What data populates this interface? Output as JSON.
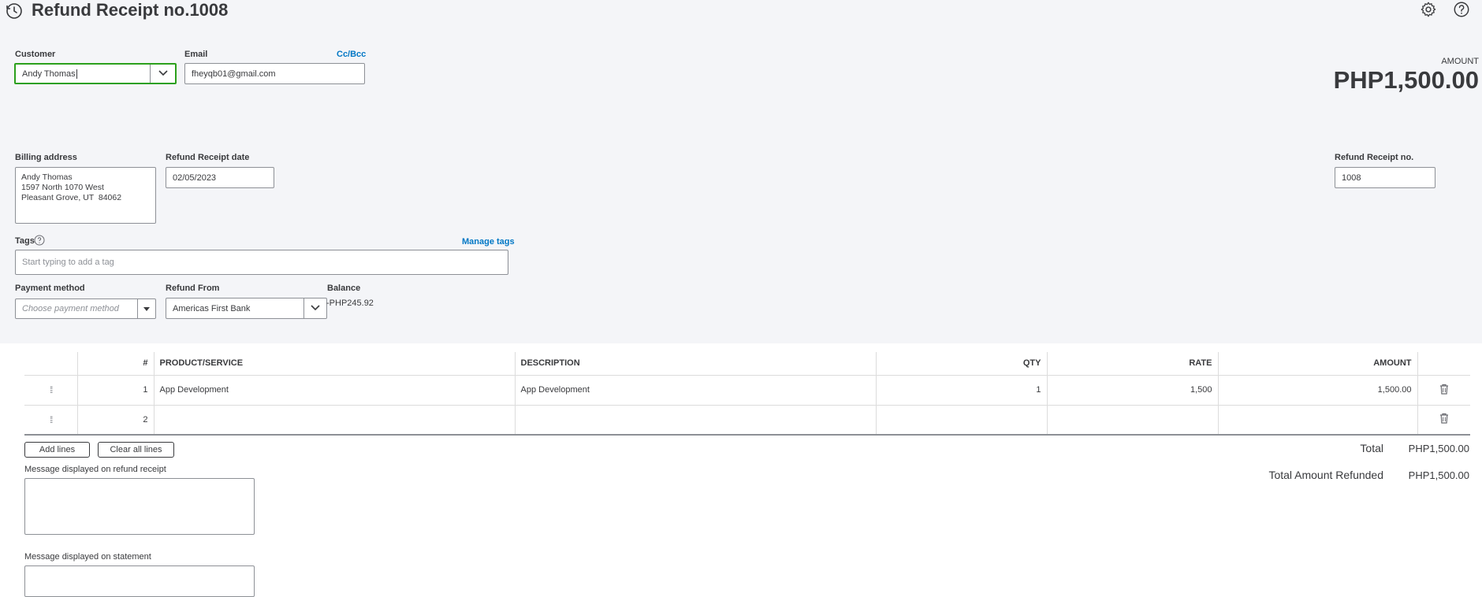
{
  "header": {
    "title": "Refund Receipt no.1008",
    "history_icon": "history-clock-icon",
    "settings_icon": "gear-icon",
    "help_icon": "help-icon"
  },
  "customer": {
    "label": "Customer",
    "value": "Andy Thomas"
  },
  "email": {
    "label": "Email",
    "value": "fheyqb01@gmail.com",
    "cc_bcc": "Cc/Bcc"
  },
  "amount": {
    "label": "AMOUNT",
    "value": "PHP1,500.00"
  },
  "billing": {
    "label": "Billing address",
    "lines": [
      "Andy Thomas",
      "1597 North 1070 West",
      "Pleasant Grove, UT  84062"
    ]
  },
  "receipt_date": {
    "label": "Refund Receipt date",
    "value": "02/05/2023"
  },
  "receipt_no": {
    "label": "Refund Receipt no.",
    "value": "1008"
  },
  "tags": {
    "label": "Tags",
    "manage": "Manage tags",
    "placeholder": "Start typing to add a tag"
  },
  "payment_method": {
    "label": "Payment method",
    "placeholder": "Choose payment method"
  },
  "refund_from": {
    "label": "Refund From",
    "value": "Americas First Bank"
  },
  "balance": {
    "label": "Balance",
    "value": "-PHP245.92"
  },
  "table": {
    "columns": [
      "#",
      "PRODUCT/SERVICE",
      "DESCRIPTION",
      "QTY",
      "RATE",
      "AMOUNT"
    ],
    "rows": [
      {
        "num": "1",
        "product": "App Development",
        "description": "App Development",
        "qty": "1",
        "rate": "1,500",
        "amount": "1,500.00"
      },
      {
        "num": "2",
        "product": "",
        "description": "",
        "qty": "",
        "rate": "",
        "amount": ""
      }
    ]
  },
  "buttons": {
    "add_lines": "Add lines",
    "clear_all_lines": "Clear all lines"
  },
  "messages": {
    "receipt_label": "Message displayed on refund receipt",
    "statement_label": "Message displayed on statement"
  },
  "totals": {
    "total_label": "Total",
    "total_value": "PHP1,500.00",
    "refunded_label": "Total Amount Refunded",
    "refunded_value": "PHP1,500.00"
  },
  "colors": {
    "link": "#0077c5",
    "focus_border": "#2ca01c",
    "header_bg": "#f4f5f8"
  }
}
